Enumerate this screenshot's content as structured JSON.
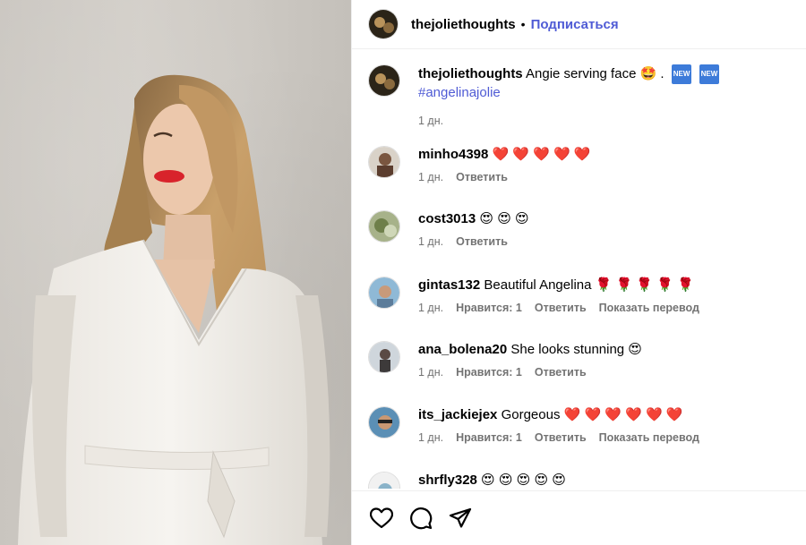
{
  "post": {
    "author": "thejoliethoughts",
    "separator": "•",
    "follow_label": "Подписаться"
  },
  "caption": {
    "username": "thejoliethoughts",
    "text": "Angie serving face 🤩 .",
    "badges": [
      "NEW",
      "NEW"
    ],
    "hashtag": "#angelinajolie",
    "time": "1 дн."
  },
  "comments": [
    {
      "username": "minho4398",
      "text": "❤️ ❤️ ❤️ ❤️ ❤️",
      "time": "1 дн.",
      "likes": "",
      "reply": "Ответить",
      "translate": ""
    },
    {
      "username": "cost3013",
      "text": "😍 😍 😍",
      "time": "1 дн.",
      "likes": "",
      "reply": "Ответить",
      "translate": ""
    },
    {
      "username": "gintas132",
      "text": "Beautiful Angelina 🌹 🌹 🌹 🌹 🌹",
      "time": "1 дн.",
      "likes": "Нравится: 1",
      "reply": "Ответить",
      "translate": "Показать перевод"
    },
    {
      "username": "ana_bolena20",
      "text": "She looks stunning 😍",
      "time": "1 дн.",
      "likes": "Нравится: 1",
      "reply": "Ответить",
      "translate": ""
    },
    {
      "username": "its_jackiejex",
      "text": "Gorgeous ❤️ ❤️ ❤️ ❤️ ❤️ ❤️",
      "time": "1 дн.",
      "likes": "Нравится: 1",
      "reply": "Ответить",
      "translate": "Показать перевод"
    },
    {
      "username": "shrfly328",
      "text": "😍 😍 😍 😍 😍",
      "time": "",
      "likes": "",
      "reply": "",
      "translate": ""
    }
  ],
  "actions": {
    "like_icon": "heart-icon",
    "comment_icon": "comment-icon",
    "share_icon": "send-icon"
  },
  "colors": {
    "accent": "#4f5bd5",
    "muted": "#737373",
    "divider": "#efefef"
  }
}
